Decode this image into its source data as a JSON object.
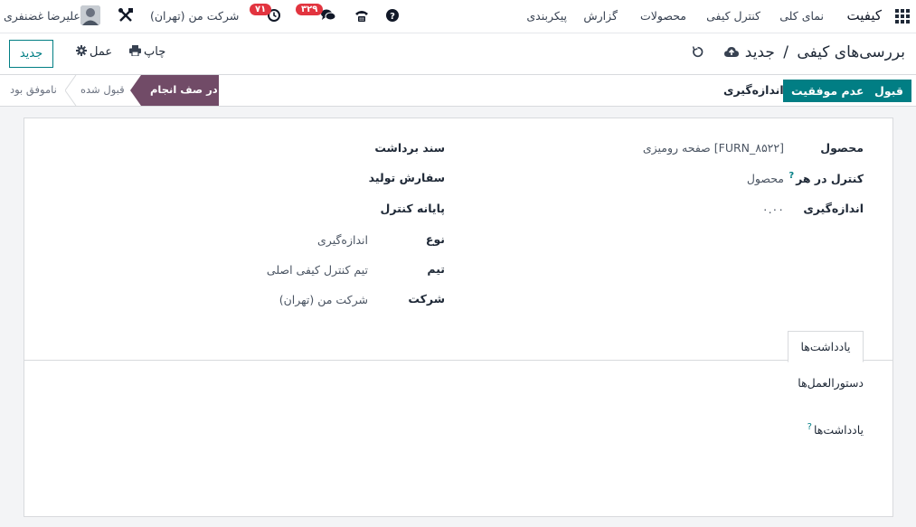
{
  "topbar": {
    "app_name": "کیفیت",
    "menu": [
      "نمای کلی",
      "کنترل کیفی",
      "محصولات",
      "گزارش",
      "پیکربندی"
    ],
    "company": "شرکت من (تهران)",
    "activity_count": "۷۱",
    "messages_count": "۳۲۹",
    "user_name": "علیرضا غضنفری"
  },
  "control": {
    "breadcrumb_parent": "بررسی‌های کیفی",
    "breadcrumb_sep": "/",
    "breadcrumb_current": "جدید",
    "print_label": "چاپ",
    "action_label": "عمل",
    "new_button": "جدید"
  },
  "status": {
    "pass_button": "قبول",
    "fail_button": "عدم موفقیت",
    "measure_button": "اندازه‌گیری",
    "stages": [
      "در صف انجام",
      "قبول شده",
      "ناموفق بود"
    ],
    "active_stage": "در صف انجام"
  },
  "form": {
    "right": [
      {
        "label": "محصول",
        "value": "[FURN_۸۵۲۲] صفحه رومیزی"
      },
      {
        "label": "کنترل در هر",
        "value": "محصول"
      },
      {
        "label": "اندازه‌گیری",
        "value": "۰.۰۰"
      }
    ],
    "left_headers": [
      "سند برداشت",
      "سفارش تولید",
      "پایانه کنترل"
    ],
    "left": [
      {
        "label": "نوع",
        "value": "اندازه‌گیری"
      },
      {
        "label": "تیم",
        "value": "تیم کنترل کیفی اصلی"
      },
      {
        "label": "شرکت",
        "value": "شرکت من (تهران)"
      }
    ],
    "help_mark": "?"
  },
  "notebook": {
    "tab_label": "یادداشت‌ها",
    "instructions_label": "دستورالعمل‌ها",
    "notes_label": "یادداشت‌ها"
  },
  "colors": {
    "primary": "#017e84",
    "stage_active": "#714b67",
    "badge": "#e2343f"
  }
}
